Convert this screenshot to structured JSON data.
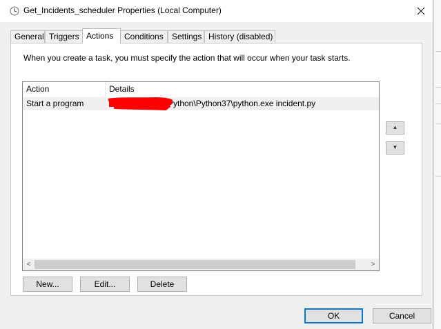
{
  "window": {
    "title": "Get_Incidents_scheduler Properties (Local Computer)",
    "close_glyph": "✕"
  },
  "tabs": [
    {
      "label": "General"
    },
    {
      "label": "Triggers"
    },
    {
      "label": "Actions"
    },
    {
      "label": "Conditions"
    },
    {
      "label": "Settings"
    },
    {
      "label": "History (disabled)"
    }
  ],
  "active_tab": "Actions",
  "panel": {
    "intro_text": "When you create a task, you must specify the action that will occur when your task starts."
  },
  "list": {
    "columns": [
      "Action",
      "Details"
    ],
    "rows": [
      {
        "action": "Start a program",
        "details": "Python\\Python37\\python.exe incident.py"
      }
    ],
    "scroll_left": "<",
    "scroll_right": ">"
  },
  "side_buttons": {
    "move_up": "▲",
    "move_down": "▼"
  },
  "buttons": {
    "new": "New...",
    "edit": "Edit...",
    "delete": "Delete",
    "ok": "OK",
    "cancel": "Cancel"
  },
  "colors": {
    "accent": "#0078d7",
    "redaction": "#ff0000"
  }
}
